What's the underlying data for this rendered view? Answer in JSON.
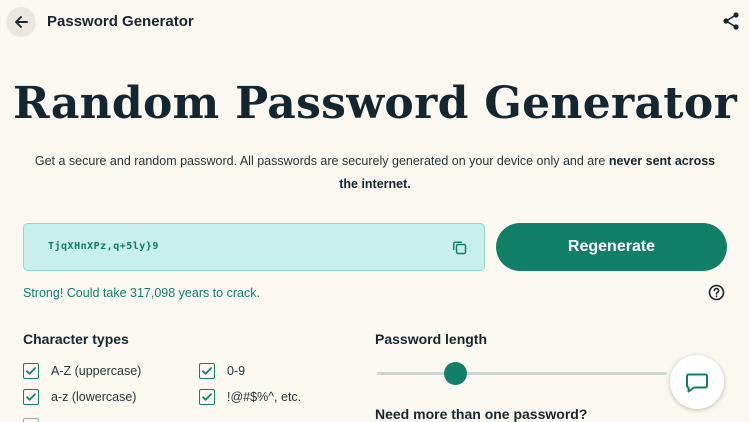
{
  "header": {
    "title": "Password Generator"
  },
  "hero": {
    "title": "Random Password Generator",
    "subtitle_plain": "Get a secure and random password. All passwords are securely generated on your device only and are ",
    "subtitle_bold": "never sent across the internet."
  },
  "password": {
    "value": "TjqXHnXPz,q+5ly}9",
    "regenerate_label": "Regenerate",
    "strength_text": "Strong! Could take 317,098 years to crack."
  },
  "character_types": {
    "title": "Character types",
    "options": [
      {
        "label": "A-Z (uppercase)",
        "checked": true
      },
      {
        "label": "0-9",
        "checked": true
      },
      {
        "label": "a-z (lowercase)",
        "checked": true
      },
      {
        "label": "!@#$%^, etc.",
        "checked": true
      }
    ]
  },
  "password_length": {
    "title": "Password length",
    "slider_fraction": 0.27
  },
  "multiple": {
    "title": "Need more than one password?"
  },
  "colors": {
    "accent": "#118067",
    "password_box_bg": "#c8efe9",
    "page_bg": "#fbf8f1",
    "text_dark": "#16262e"
  },
  "icons": {
    "back": "arrow-left-icon",
    "share": "share-icon",
    "copy": "copy-icon",
    "help": "question-circle-icon",
    "chat": "chat-bubble-icon",
    "checkbox": "checkmark-icon"
  }
}
